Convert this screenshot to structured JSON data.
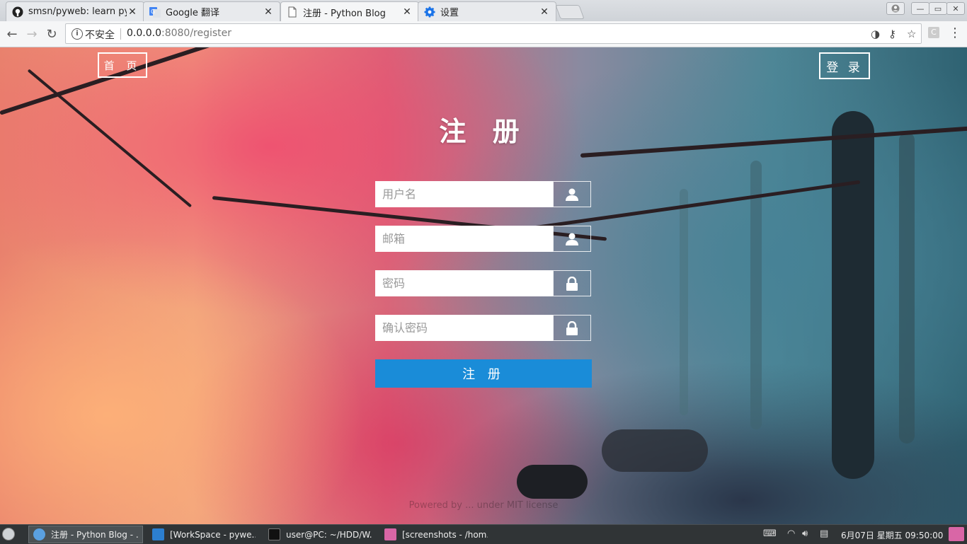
{
  "browser": {
    "tabs": [
      {
        "title": "smsn/pyweb: learn py",
        "icon": "github-icon",
        "active": false
      },
      {
        "title": "Google 翻译",
        "icon": "google-translate-icon",
        "active": false
      },
      {
        "title": "注册 - Python Blog",
        "icon": "page-icon",
        "active": true
      },
      {
        "title": "设置",
        "icon": "settings-gear-icon",
        "active": false
      }
    ],
    "security_label": "不安全",
    "url_host": "0.0.0.0",
    "url_rest": ":8080/register",
    "extension_label": "C"
  },
  "page": {
    "home_label": "首 页",
    "login_label": "登 录",
    "heading": "注 册",
    "fields": [
      {
        "placeholder": "用户名",
        "icon": "user-icon"
      },
      {
        "placeholder": "邮箱",
        "icon": "user-icon"
      },
      {
        "placeholder": "密码",
        "icon": "lock-icon"
      },
      {
        "placeholder": "确认密码",
        "icon": "lock-icon"
      }
    ],
    "submit_label": "注 册",
    "footer": "Powered by ... under MIT license"
  },
  "taskbar": {
    "items": [
      {
        "label": "注册 - Python Blog - ...",
        "active": true,
        "icon": "chromium-icon",
        "color": "#5aa0e0"
      },
      {
        "label": "[WorkSpace - pywe...",
        "active": false,
        "icon": "vscode-icon",
        "color": "#2c7fd0"
      },
      {
        "label": "user@PC: ~/HDD/W...",
        "active": false,
        "icon": "terminal-icon",
        "color": "#222222"
      },
      {
        "label": "[screenshots - /hom...",
        "active": false,
        "icon": "folder-icon",
        "color": "#d966a6"
      }
    ],
    "clock": "6月07日 星期五 09:50:00"
  },
  "colors": {
    "submit": "#1a8cd8",
    "taskbar": "#303436"
  }
}
